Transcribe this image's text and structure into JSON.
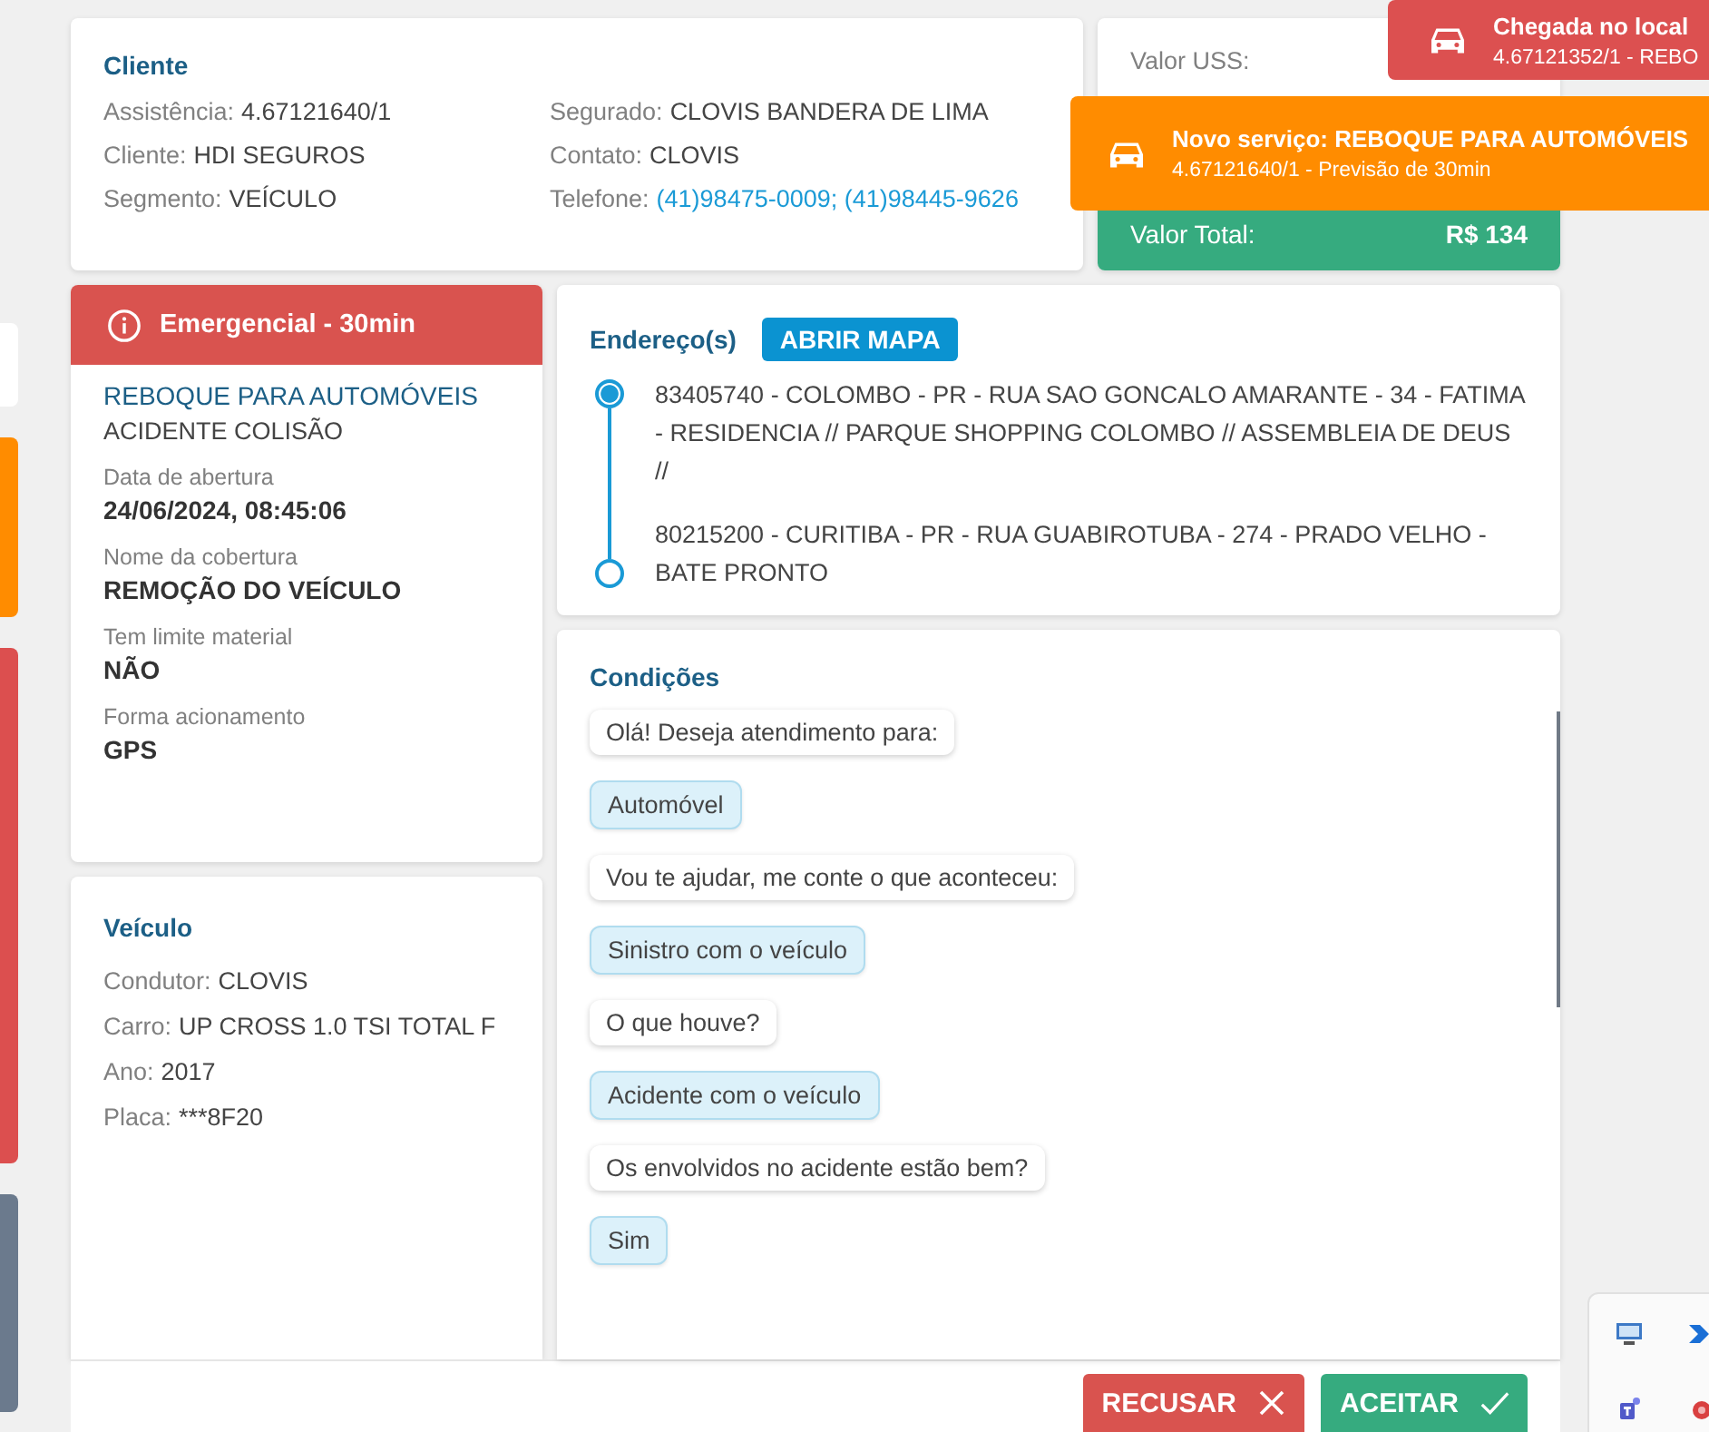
{
  "side_tabs": [
    {
      "color": "#ffffff"
    },
    {
      "color": "#ff8c00"
    },
    {
      "color": "#dc4f4f"
    },
    {
      "color": "#6b7a8d"
    }
  ],
  "client": {
    "title": "Cliente",
    "fields": [
      {
        "label": "Assistência:",
        "value": "4.67121640/1",
        "kind": "text"
      },
      {
        "label": "Segurado:",
        "value": "CLOVIS BANDERA DE LIMA",
        "kind": "text"
      },
      {
        "label": "Cliente:",
        "value": "HDI SEGUROS",
        "kind": "text"
      },
      {
        "label": "Contato:",
        "value": "CLOVIS",
        "kind": "text"
      },
      {
        "label": "Segmento:",
        "value": "VEÍCULO",
        "kind": "text"
      },
      {
        "label": "Telefone:",
        "value": "(41)98475-0009; (41)98445-9626",
        "kind": "link"
      }
    ]
  },
  "values": {
    "uss_label": "Valor USS:",
    "total_label": "Valor Total:",
    "total_value": "R$ 134"
  },
  "service": {
    "priority": "Emergencial - 30min",
    "type": "REBOQUE PARA AUTOMÓVEIS",
    "cause": "ACIDENTE COLISÃO",
    "details": [
      {
        "label": "Data de abertura",
        "value": "24/06/2024, 08:45:06"
      },
      {
        "label": "Nome da cobertura",
        "value": "REMOÇÃO DO VEÍCULO"
      },
      {
        "label": "Tem limite material",
        "value": "NÃO"
      },
      {
        "label": "Forma acionamento",
        "value": "GPS"
      }
    ]
  },
  "vehicle": {
    "title": "Veículo",
    "fields": [
      {
        "label": "Condutor:",
        "value": "CLOVIS"
      },
      {
        "label": "Carro:",
        "value": "UP CROSS 1.0 TSI TOTAL F"
      },
      {
        "label": "Ano:",
        "value": "2017"
      },
      {
        "label": "Placa:",
        "value": "***8F20"
      }
    ]
  },
  "addresses": {
    "title": "Endereço(s)",
    "map_button": "ABRIR MAPA",
    "items": [
      {
        "kind": "origin",
        "text": "83405740 - COLOMBO - PR - RUA SAO GONCALO AMARANTE - 34 - FATIMA - RESIDENCIA // PARQUE SHOPPING COLOMBO // ASSEMBLEIA DE DEUS //"
      },
      {
        "kind": "destination",
        "text": "80215200 - CURITIBA - PR - RUA GUABIROTUBA - 274 - PRADO VELHO - BATE PRONTO"
      }
    ]
  },
  "conditions": {
    "title": "Condições",
    "messages": [
      {
        "kind": "question",
        "text": "Olá! Deseja atendimento para:"
      },
      {
        "kind": "answer",
        "text": "Automóvel"
      },
      {
        "kind": "question",
        "text": "Vou te ajudar, me conte o que aconteceu:"
      },
      {
        "kind": "answer",
        "text": "Sinistro com o veículo"
      },
      {
        "kind": "question",
        "text": "O que houve?"
      },
      {
        "kind": "answer",
        "text": "Acidente com o veículo"
      },
      {
        "kind": "question",
        "text": "Os envolvidos no acidente estão bem?"
      },
      {
        "kind": "answer",
        "text": "Sim"
      }
    ]
  },
  "actions": [
    {
      "kind": "reject",
      "label": "RECUSAR"
    },
    {
      "kind": "accept",
      "label": "ACEITAR"
    }
  ],
  "notifications": [
    {
      "title": "Chegada no local",
      "subtitle": "4.67121352/1 - REBO",
      "color": "#dc5050"
    },
    {
      "title": "Novo serviço: REBOQUE PARA AUTOMÓVEIS",
      "subtitle": "4.67121640/1 - Previsão de 30min",
      "color": "#ff8c00"
    }
  ]
}
